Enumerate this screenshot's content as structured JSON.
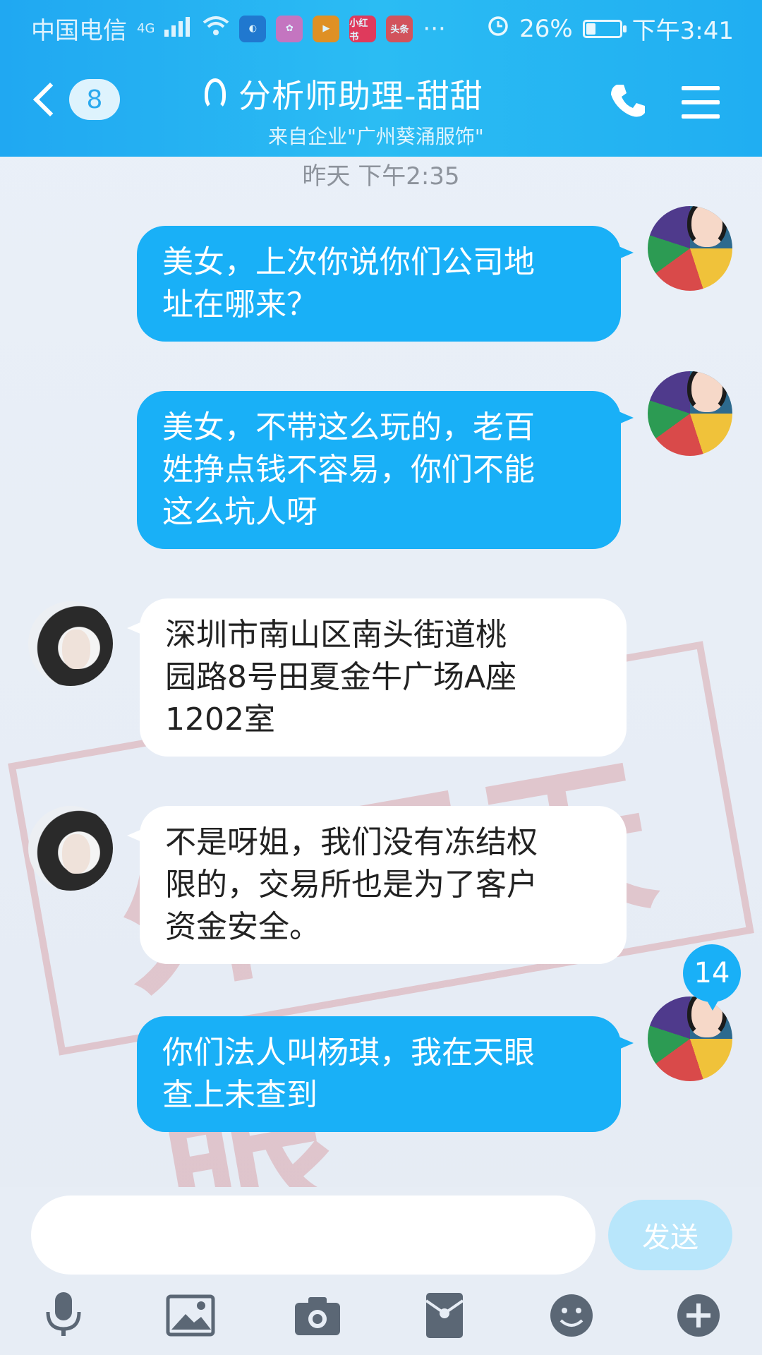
{
  "status_bar": {
    "carrier": "中国电信",
    "network": "4G",
    "app_icons": [
      "小红书",
      "头条"
    ],
    "more": "···",
    "battery": "26%",
    "battery_level": 0.26,
    "time": "下午3:41"
  },
  "header": {
    "unread_count": "8",
    "title": "分析师助理-甜甜",
    "subtitle": "来自企业\"广州葵涌服饰\""
  },
  "chat": {
    "timestamp": "昨天 下午2:35",
    "messages": [
      {
        "side": "right",
        "lines": [
          "美女，上次你说你们公司地",
          "址在哪来？"
        ]
      },
      {
        "side": "right",
        "lines": [
          "美女，不带这么玩的，老百",
          "姓挣点钱不容易，你们不能",
          "这么坑人呀"
        ]
      },
      {
        "side": "left",
        "lines": [
          "深圳市南山区南头街道桃",
          "园路8号田夏金牛广场A座",
          "1202室"
        ]
      },
      {
        "side": "left",
        "lines": [
          "不是呀姐，我们没有冻结权",
          "限的，交易所也是为了客户",
          "资金安全。"
        ]
      },
      {
        "side": "right",
        "lines": [
          "你们法人叫杨琪，我在天眼",
          "查上未查到"
        ]
      }
    ],
    "unread_badge": "14"
  },
  "input": {
    "placeholder": "",
    "send_label": "发送"
  },
  "toolbar": {
    "icons": [
      "microphone-icon",
      "image-icon",
      "camera-icon",
      "red-packet-icon",
      "emoji-icon",
      "plus-icon"
    ]
  },
  "watermark": {
    "text": "外汇天眼"
  },
  "colors": {
    "header": "#20a8f2",
    "bubble_self": "#19b0f7",
    "bubble_other": "#ffffff",
    "background": "#e9eef6"
  }
}
